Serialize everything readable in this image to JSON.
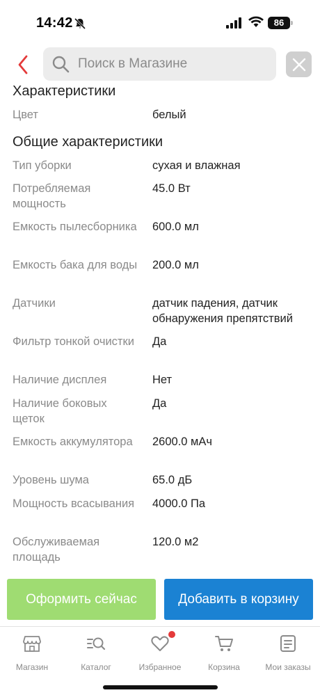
{
  "status_bar": {
    "time": "14:42",
    "battery": "86",
    "icons": [
      "bell-slash-icon",
      "signal-icon",
      "wifi-icon",
      "battery-icon"
    ]
  },
  "header": {
    "search_placeholder": "Поиск в Магазине",
    "icons": [
      "chevron-left-icon",
      "search-icon",
      "close-icon"
    ],
    "accent_color": "#e43a3a"
  },
  "specs": {
    "section1_title": "Характеристики",
    "section1_rows": [
      {
        "label": "Цвет",
        "value": "белый"
      }
    ],
    "section2_title": "Общие характеристики",
    "section2_rows": [
      {
        "label": "Тип уборки",
        "value": "сухая и влажная"
      },
      {
        "label": "Потребляемая мощность",
        "value": "45.0 Вт"
      },
      {
        "label": "Емкость пылесборника",
        "value": "600.0 мл"
      },
      {
        "label": "Емкость бака для воды",
        "value": "200.0 мл"
      },
      {
        "label": "Датчики",
        "value": "датчик падения, датчик обнаружения препятствий"
      },
      {
        "label": "Фильтр тонкой очистки",
        "value": "Да"
      },
      {
        "label": "Наличие дисплея",
        "value": "Нет"
      },
      {
        "label": "Наличие боковых щеток",
        "value": "Да"
      },
      {
        "label": "Емкость аккумулятора",
        "value": "2600.0 мАч"
      },
      {
        "label": "Уровень шума",
        "value": "65.0 дБ"
      },
      {
        "label": "Мощность всасывания",
        "value": "4000.0 Па"
      },
      {
        "label": "Обслуживаемая площадь",
        "value": "120.0 м2"
      }
    ]
  },
  "actions": {
    "buy_now": "Оформить сейчас",
    "add_to_cart": "Добавить в корзину",
    "buy_now_color": "#9fdc72",
    "add_to_cart_color": "#1b82d3"
  },
  "tab_bar": {
    "items": [
      {
        "label": "Магазин",
        "icon": "store-icon"
      },
      {
        "label": "Каталог",
        "icon": "catalog-search-icon"
      },
      {
        "label": "Избранное",
        "icon": "heart-icon"
      },
      {
        "label": "Корзина",
        "icon": "cart-icon"
      },
      {
        "label": "Мои заказы",
        "icon": "orders-icon"
      }
    ]
  }
}
